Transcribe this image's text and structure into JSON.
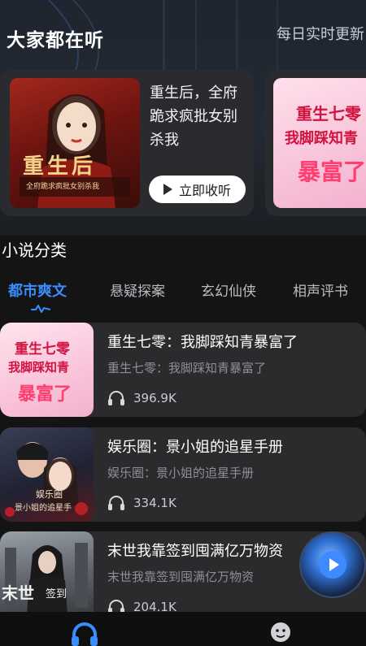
{
  "header": {
    "title": "大家都在听",
    "subtitle": "每日实时更新"
  },
  "featured": [
    {
      "title": "重生后，全府跪求疯批女别杀我",
      "cover_text": "重生后",
      "cover_subtext": "全府跪求疯批女别杀我",
      "button_label": "立即收听"
    },
    {
      "cover_line1": "重生七零",
      "cover_line2": "我脚踩知青",
      "cover_line3": "暴富了"
    }
  ],
  "section": {
    "title": "小说分类"
  },
  "tabs": [
    {
      "label": "都市爽文",
      "active": true
    },
    {
      "label": "悬疑探案",
      "active": false
    },
    {
      "label": "玄幻仙侠",
      "active": false
    },
    {
      "label": "相声评书",
      "active": false
    }
  ],
  "books": [
    {
      "title": "重生七零：我脚踩知青暴富了",
      "desc": "重生七零：我脚踩知青暴富了",
      "plays": "396.9K",
      "cover_line1": "重生七零",
      "cover_line2": "我脚踩知青",
      "cover_line3": "暴富了"
    },
    {
      "title": "娱乐圈：景小姐的追星手册",
      "desc": "娱乐圈：景小姐的追星手册",
      "plays": "334.1K",
      "cover_line1": "娱乐圈",
      "cover_line2": "景小姐的追星手"
    },
    {
      "title": "末世我靠签到囤满亿万物资",
      "desc": "末世我靠签到囤满亿万物资",
      "plays": "204.1K",
      "cover_line1": "末世",
      "cover_line2": "签到"
    }
  ],
  "colors": {
    "accent": "#3a8dff",
    "background": "#141414",
    "card": "#2b2b2d"
  },
  "icons": {
    "headphones": "headphones-icon",
    "play": "play-icon",
    "nav_listen": "headphones-nav-icon",
    "nav_profile": "profile-icon"
  }
}
